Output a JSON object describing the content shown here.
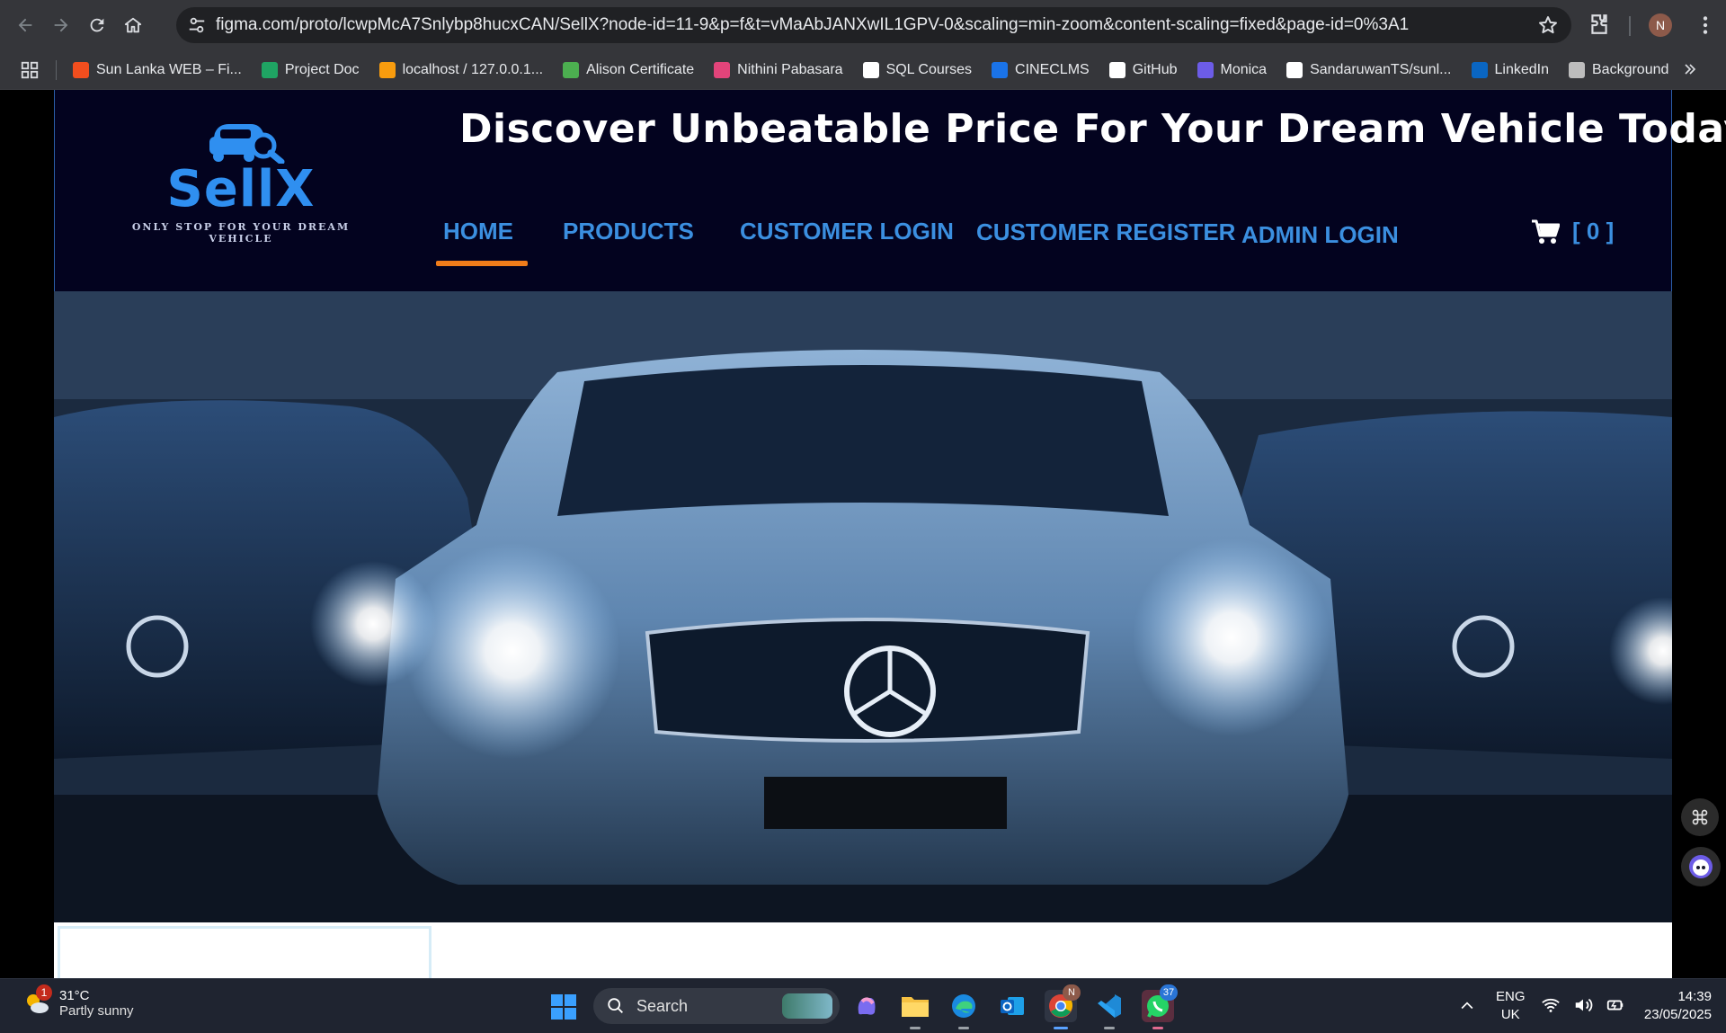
{
  "browser": {
    "url": "figma.com/proto/lcwpMcA7Snlybp8hucxCAN/SellX?node-id=11-9&p=f&t=vMaAbJANXwIL1GPV-0&scaling=min-zoom&content-scaling=fixed&page-id=0%3A1",
    "profile_initial": "N",
    "bookmarks": [
      {
        "label": "Sun Lanka WEB – Fi...",
        "color": "#f24e1e"
      },
      {
        "label": "Project Doc",
        "color": "#1fa463"
      },
      {
        "label": "localhost / 127.0.0.1...",
        "color": "#f89c0e"
      },
      {
        "label": "Alison Certificate",
        "color": "#4caf50"
      },
      {
        "label": "Nithini Pabasara",
        "color": "#e2447a"
      },
      {
        "label": "SQL Courses",
        "color": "#ffffff"
      },
      {
        "label": "CINECLMS",
        "color": "#1a73e8"
      },
      {
        "label": "GitHub",
        "color": "#ffffff"
      },
      {
        "label": "Monica",
        "color": "#6c5ce7"
      },
      {
        "label": "SandaruwanTS/sunl...",
        "color": "#ffffff"
      },
      {
        "label": "LinkedIn",
        "color": "#0a66c2"
      },
      {
        "label": "Background",
        "color": "#bdbdbd"
      }
    ]
  },
  "site": {
    "logo_word": "SellX",
    "logo_tagline": "ONLY STOP FOR YOUR DREAM VEHICLE",
    "headline": "Discover Unbeatable Price For Your Dream Vehicle Today.",
    "nav": {
      "home": "HOME",
      "products": "PRODUCTS",
      "customer_login": "CUSTOMER LOGIN",
      "customer_register": "CUSTOMER REGISTER",
      "admin_login": "ADMIN LOGIN"
    },
    "cart_count": "[ 0 ]",
    "colors": {
      "header_bg": "#03031f",
      "nav_link": "#3b8fe0",
      "active_underline": "#f07d1a",
      "brand": "#2f8ff0"
    }
  },
  "taskbar": {
    "weather_badge": "1",
    "weather_temp": "31°C",
    "weather_desc": "Partly sunny",
    "search_label": "Search",
    "chrome_badge": "N",
    "whatsapp_badge": "37",
    "lang_line1": "ENG",
    "lang_line2": "UK",
    "time": "14:39",
    "date": "23/05/2025"
  }
}
